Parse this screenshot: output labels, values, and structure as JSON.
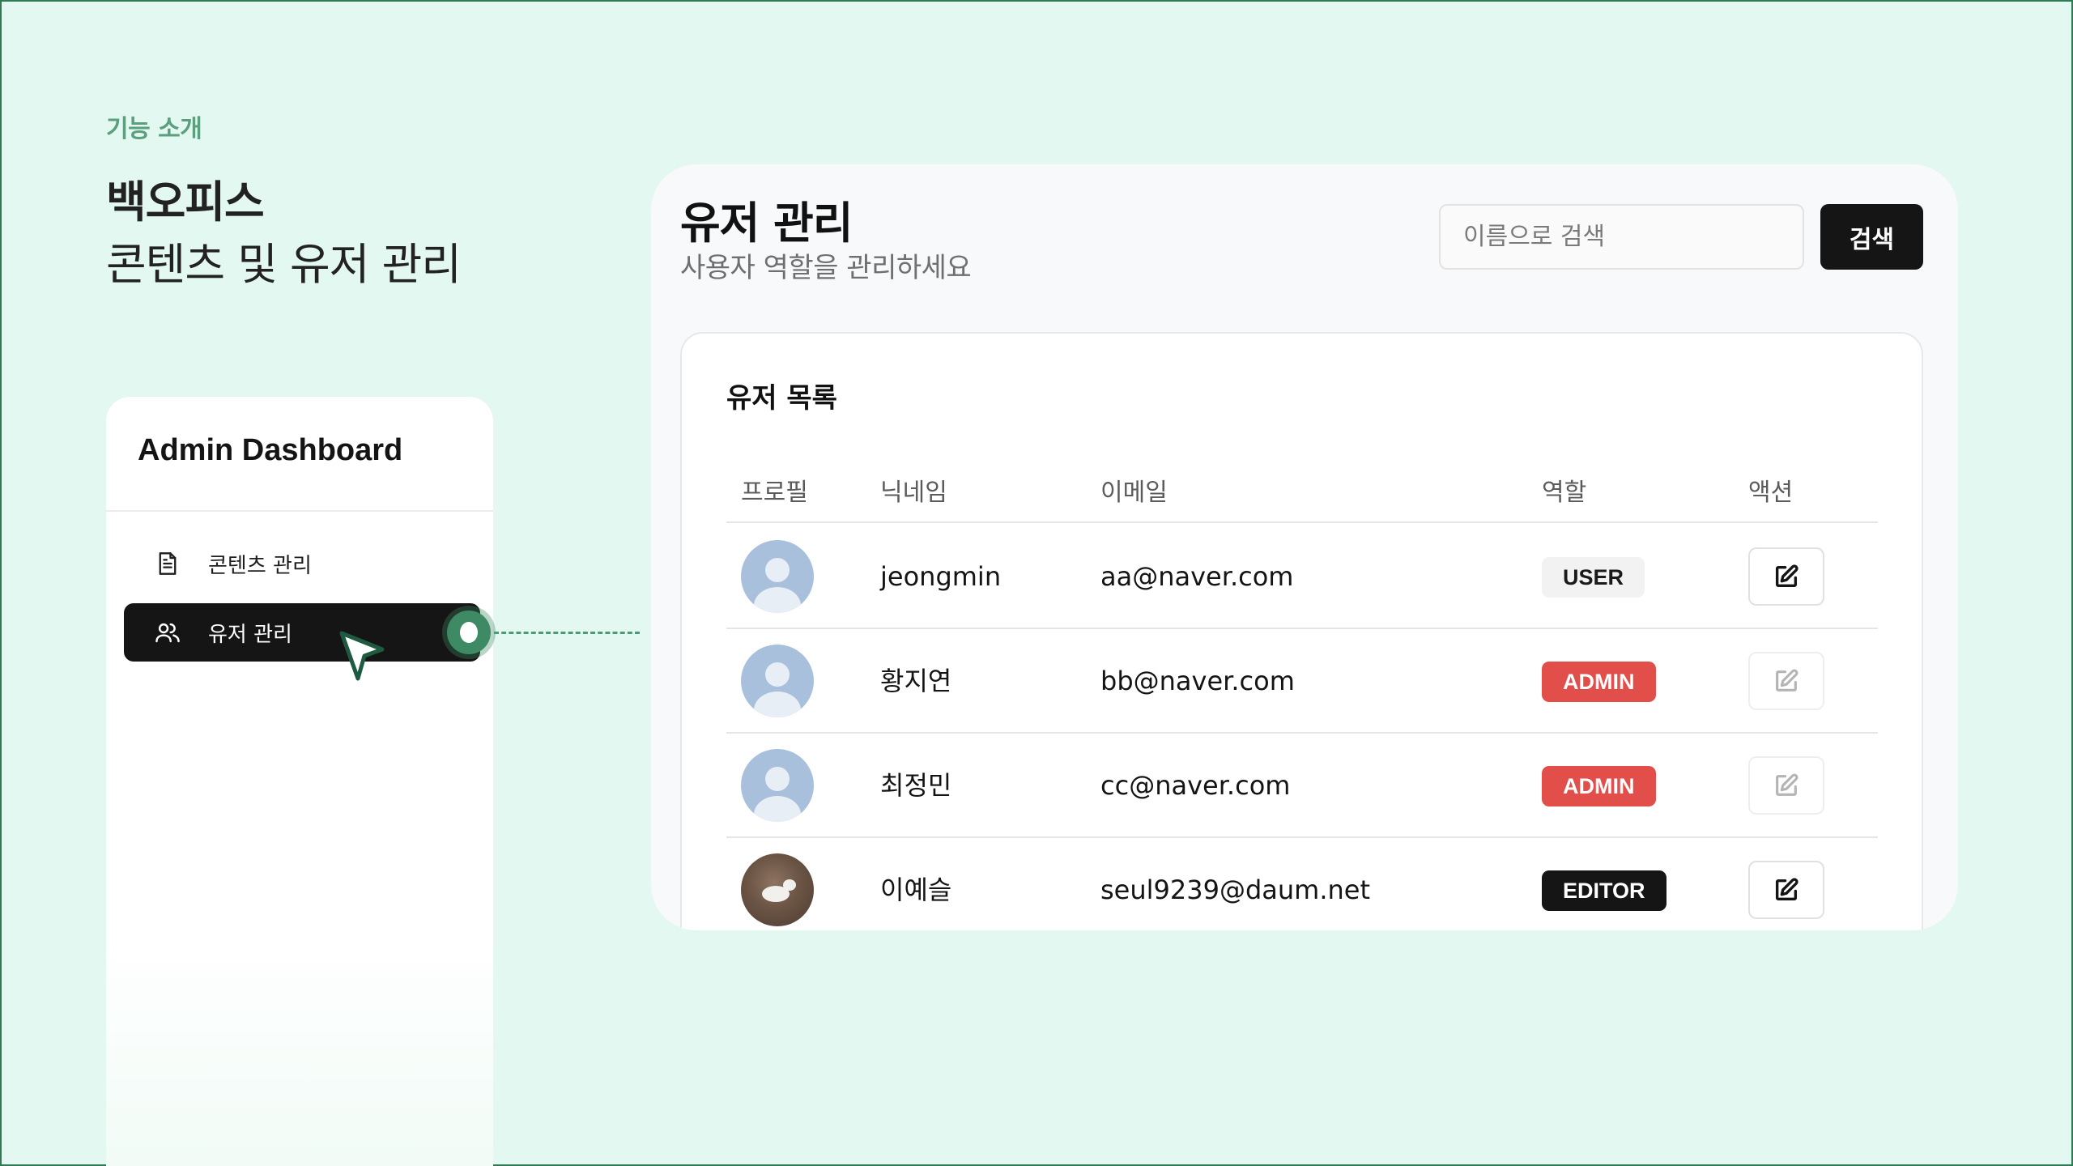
{
  "intro": {
    "eyebrow": "기능 소개",
    "headline": "백오피스",
    "subheadline": "콘텐츠 및 유저 관리"
  },
  "sidebar": {
    "title": "Admin Dashboard",
    "items": [
      {
        "label": "콘텐츠 관리",
        "icon": "document-icon",
        "active": false
      },
      {
        "label": "유저 관리",
        "icon": "users-icon",
        "active": true
      }
    ]
  },
  "main": {
    "title": "유저 관리",
    "subtitle": "사용자 역할을 관리하세요",
    "search": {
      "placeholder": "이름으로 검색",
      "value": "",
      "button_label": "검색"
    },
    "card": {
      "title": "유저 목록",
      "columns": [
        "프로필",
        "닉네임",
        "이메일",
        "역할",
        "액션"
      ],
      "rows": [
        {
          "avatar": "default-avatar",
          "nickname": "jeongmin",
          "email": "aa@naver.com",
          "role": "USER",
          "edit_enabled": true
        },
        {
          "avatar": "default-avatar",
          "nickname": "황지연",
          "email": "bb@naver.com",
          "role": "ADMIN",
          "edit_enabled": false
        },
        {
          "avatar": "default-avatar",
          "nickname": "최정민",
          "email": "cc@naver.com",
          "role": "ADMIN",
          "edit_enabled": false
        },
        {
          "avatar": "photo-avatar",
          "nickname": "이예슬",
          "email": "seul9239@daum.net",
          "role": "EDITOR",
          "edit_enabled": true
        }
      ]
    }
  },
  "colors": {
    "background": "#e3f8f0",
    "accent_green": "#3d8a64",
    "admin_badge": "#e24e4a",
    "dark": "#151515"
  }
}
